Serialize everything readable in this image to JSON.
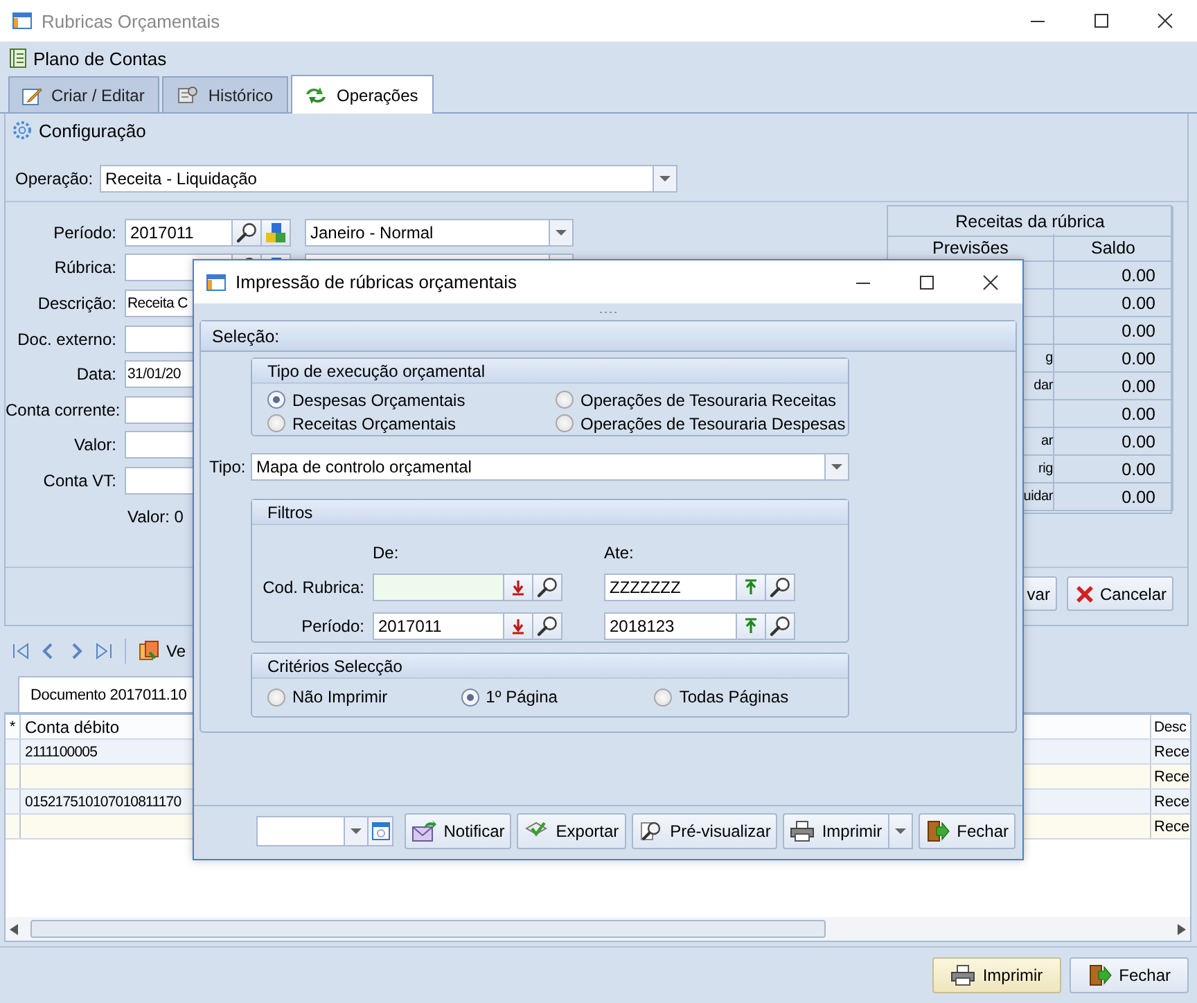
{
  "window": {
    "title": "Rubricas Orçamentais"
  },
  "menu": {
    "label": "Plano de Contas"
  },
  "tabs": [
    {
      "label": "Criar / Editar",
      "kind": "edit",
      "selected": false
    },
    {
      "label": "Histórico",
      "kind": "history",
      "selected": false
    },
    {
      "label": "Operações",
      "kind": "operations",
      "selected": true
    }
  ],
  "panel_title": "Configuração",
  "operation": {
    "label": "Operação:",
    "value": "Receita - Liquidação"
  },
  "form": [
    {
      "kind": "lookup",
      "label": "Período:",
      "value": "2017011",
      "combo": "Janeiro - Normal"
    },
    {
      "kind": "lookup",
      "label": "Rúbrica:"
    },
    {
      "kind": "text",
      "label": "Descrição:",
      "value": "Receita C"
    },
    {
      "kind": "text",
      "label": "Doc. externo:"
    },
    {
      "kind": "text",
      "label": "Data:",
      "value": "31/01/20"
    },
    {
      "kind": "text",
      "label": "Conta corrente:"
    },
    {
      "kind": "text",
      "label": "Valor:"
    },
    {
      "kind": "text",
      "label": "Conta VT:"
    }
  ],
  "total": "Valor: 0",
  "summary": {
    "title": "Receitas da rúbrica",
    "columns": [
      "Previsões",
      "Saldo"
    ],
    "rows": [
      {
        "saldo": "0.00"
      },
      {
        "saldo": "0.00"
      },
      {
        "saldo": "0.00"
      },
      {
        "previsoes": "g",
        "saldo": "0.00"
      },
      {
        "previsoes": "dar",
        "saldo": "0.00"
      },
      {
        "saldo": "0.00"
      },
      {
        "previsoes": "ar",
        "saldo": "0.00"
      },
      {
        "previsoes": "rig",
        "saldo": "0.00"
      },
      {
        "previsoes": "uidar",
        "saldo": "0.00"
      }
    ]
  },
  "actions": [
    {
      "label": "var",
      "kind": "save"
    },
    {
      "label": "Cancelar",
      "kind": "cancel"
    }
  ],
  "navigator": {
    "button": "Ve"
  },
  "document_tab": "Documento 2017011.10",
  "grid": {
    "columns": [
      "*",
      "Conta débito",
      "Desc"
    ],
    "rows": [
      {
        "conta_debito": "2111100005",
        "column_3": "Rece"
      },
      {
        "column_3": "Rece"
      },
      {
        "conta_debito": "015217510107010811170",
        "column_3": "Rece"
      },
      {
        "column_3": "Rece"
      }
    ]
  },
  "footer_buttons": [
    {
      "label": "Imprimir",
      "kind": "print",
      "highlighted": true
    },
    {
      "label": "Fechar",
      "kind": "close",
      "highlighted": false
    }
  ],
  "dialog": {
    "title": "Impressão de rúbricas orçamentais",
    "section": "Seleção:",
    "execution_type": {
      "title": "Tipo de execução orçamental",
      "options": [
        {
          "label": "Despesas Orçamentais",
          "selected": true
        },
        {
          "label": "Operações de Tesouraria Receitas",
          "selected": false
        },
        {
          "label": "Receitas Orçamentais",
          "selected": false
        },
        {
          "label": "Operações de Tesouraria Despesas",
          "selected": false
        }
      ]
    },
    "tipo": {
      "label": "Tipo:",
      "value": "Mapa de controlo orçamental"
    },
    "filters": {
      "title": "Filtros",
      "from_label": "De:",
      "to_label": "Ate:",
      "rows": [
        {
          "label": "Cod. Rubrica:",
          "from_highlighted": true,
          "to": "ZZZZZZZ"
        },
        {
          "label": "Período:",
          "from": "2017011",
          "from_highlighted": false,
          "to": "2018123"
        }
      ]
    },
    "criteria": {
      "title": "Critérios Selecção",
      "options": [
        {
          "label": "Não Imprimir",
          "selected": false
        },
        {
          "label": "1º Página",
          "selected": true
        },
        {
          "label": "Todas Páginas",
          "selected": false
        }
      ]
    },
    "buttons": [
      {
        "label": "Notificar",
        "kind": "notify"
      },
      {
        "label": "Exportar",
        "kind": "export"
      },
      {
        "label": "Pré-visualizar",
        "kind": "preview"
      },
      {
        "label": "Imprimir",
        "kind": "print"
      },
      {
        "label": "Fechar",
        "kind": "close"
      }
    ]
  }
}
